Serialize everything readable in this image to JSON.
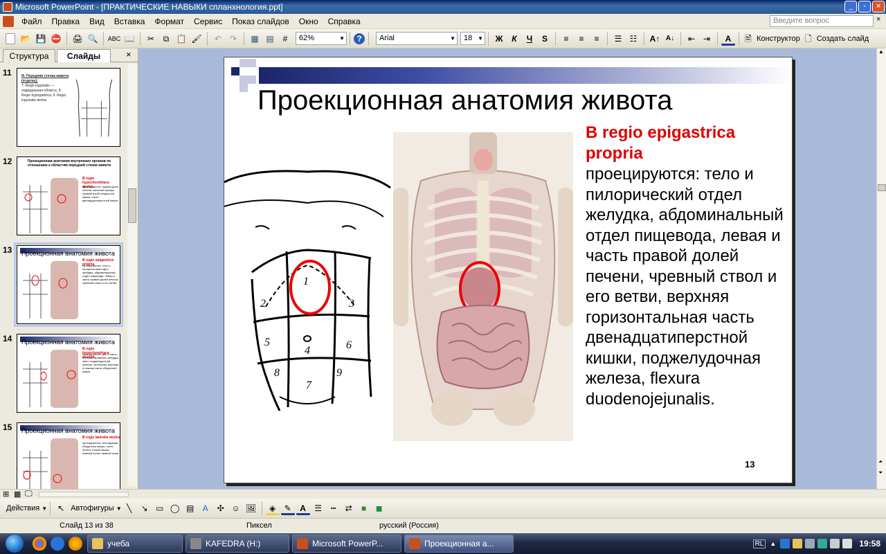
{
  "window": {
    "title": "Microsoft PowerPoint - [ПРАКТИЧЕСКИЕ НАВЫКИ спланхнология.ppt]"
  },
  "menu": {
    "items": [
      "Файл",
      "Правка",
      "Вид",
      "Вставка",
      "Формат",
      "Сервис",
      "Показ слайдов",
      "Окно",
      "Справка"
    ],
    "help_placeholder": "Введите вопрос"
  },
  "toolbar": {
    "zoom": "62%",
    "font": "Arial",
    "font_size": "18",
    "bold": "Ж",
    "italic": "К",
    "underline": "Ч",
    "shadow": "S",
    "design": "Конструктор",
    "new_slide": "Создать слайд"
  },
  "pane": {
    "tab_outline": "Структура",
    "tab_slides": "Слайды",
    "close": "×"
  },
  "thumbnails": [
    {
      "num": "11",
      "title": "III. Передняя стенка живота (отделы):",
      "red": "",
      "body": "7. Regio inguinalis — подвздошная область; 8. Regio hypogastrica; 9. Regio inguinalis dextra"
    },
    {
      "num": "12",
      "title": "Проекционная анатомия внутренних органов по отношению к областям передней стенки живота",
      "red": "В regio hypochondriaca dextra",
      "body": "проецируются: правая доля печени, желчный пузырь, правый изгиб ободочной кишки, часть двенадцатиперстной кишки"
    },
    {
      "num": "13",
      "title": "Проекционная анатомия живота",
      "red": "В regio epigastrica propria",
      "body": "проецируются: тело и пилорический отдел желудка, абдоминальный отдел пищевода, левая и часть правой долей печени, чревный ствол и его ветви"
    },
    {
      "num": "14",
      "title": "Проекционная анатомия живота",
      "red": "В regio hypochondriaca sinistra",
      "body": "проецируются: дно и часть большой кривизны желудка, хвост поджелудочной железы, селезенка, верхняя и нижняя части ободочной кишки"
    },
    {
      "num": "15",
      "title": "Проекционная анатомия живота",
      "red": "В regio lateralis dextra",
      "body": "проецируются: восходящая ободочная кишка, часть петель тонкой кишки, нижний полюс правой почки"
    }
  ],
  "slide": {
    "title": "Проекционная анатомия живота",
    "red": "В regio epigastrica propria",
    "body": "проецируются: тело и пилорический отдел желудка, абдоминальный отдел пищевода, левая и часть правой долей печени, чревный ствол и его ветви, верхняя горизонтальная часть двенадцатиперстной кишки, поджелудочная железа, flexura duodenojejunalis.",
    "number": "13",
    "region_labels": [
      "1",
      "2",
      "3",
      "4",
      "5",
      "6",
      "7",
      "8",
      "9"
    ]
  },
  "drawbar": {
    "actions": "Действия",
    "autoshapes": "Автофигуры"
  },
  "status": {
    "slide": "Слайд 13 из 38",
    "design": "Пиксел",
    "lang": "русский (Россия)"
  },
  "taskbar": {
    "items": [
      "учеба",
      "KAFEDRA (H:)",
      "Microsoft PowerP...",
      "Проекционная а..."
    ],
    "lang": "RL",
    "clock": "19:58"
  }
}
